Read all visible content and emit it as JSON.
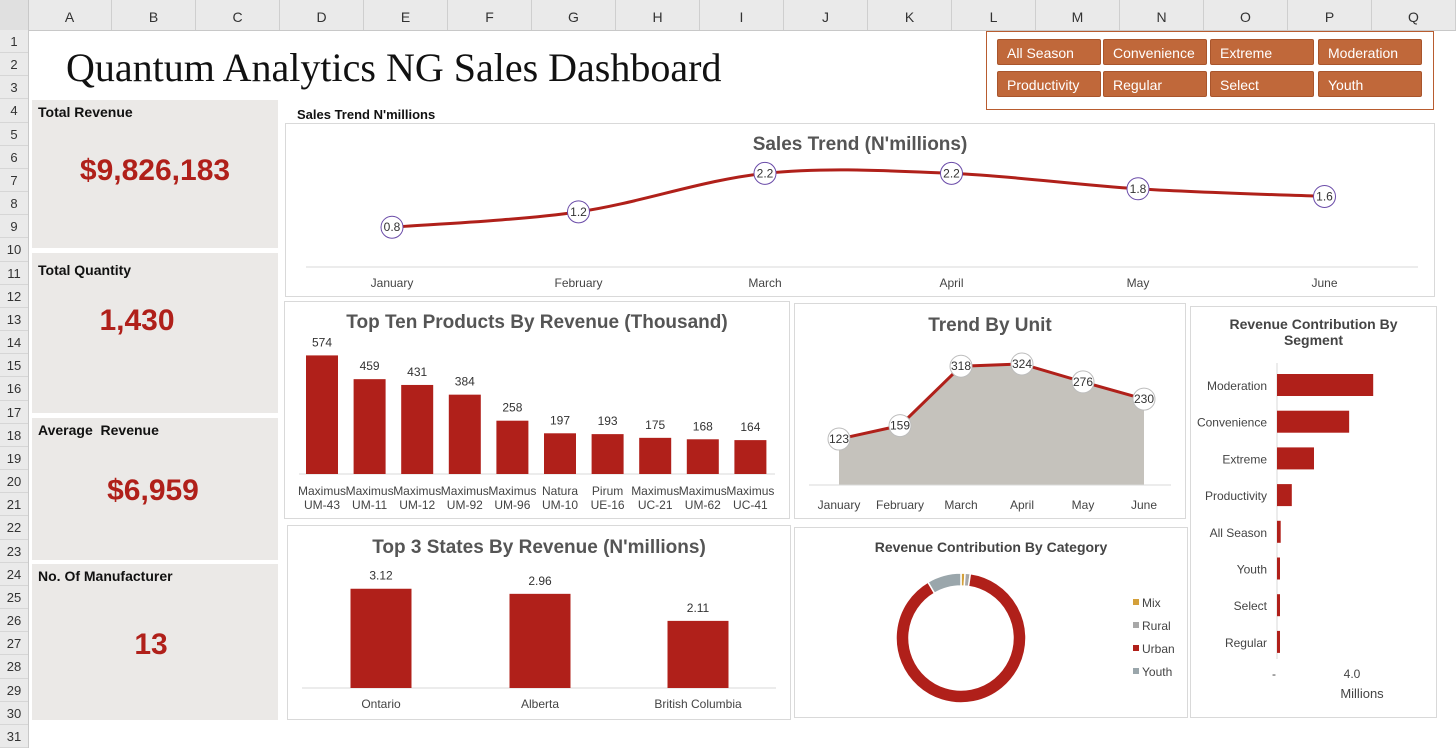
{
  "sheet": {
    "columns": [
      "A",
      "B",
      "C",
      "D",
      "E",
      "F",
      "G",
      "H",
      "I",
      "J",
      "K",
      "L",
      "M",
      "N",
      "O",
      "P",
      "Q"
    ],
    "rows": [
      "1",
      "2",
      "3",
      "4",
      "5",
      "6",
      "7",
      "8",
      "9",
      "10",
      "11",
      "12",
      "13",
      "14",
      "15",
      "16",
      "17",
      "18",
      "19",
      "20",
      "21",
      "22",
      "23",
      "24",
      "25",
      "26",
      "27",
      "28",
      "29",
      "30",
      "31"
    ]
  },
  "dashboard_title": "Quantum Analytics NG Sales Dashboard",
  "slicer": {
    "items": [
      "All Season",
      "Convenience",
      "Extreme",
      "Moderation",
      "Productivity",
      "Regular",
      "Select",
      "Youth"
    ]
  },
  "kpis": {
    "revenue": {
      "label": "Total Revenue",
      "value": "$9,826,183"
    },
    "quantity": {
      "label": "Total Quantity",
      "value": "1,430"
    },
    "average": {
      "label": "Average  Revenue",
      "value": "$6,959"
    },
    "manufacturers": {
      "label": "No. Of Manufacturer",
      "value": "13"
    }
  },
  "sales_trend_caption": "Sales Trend N'millions",
  "colors": {
    "accent": "#b0201a",
    "slicer": "#c0683a",
    "area": "#c5c2bc",
    "marker": "#6a4ba8",
    "panel_title": "#555555"
  },
  "chart_data": [
    {
      "id": "sales_trend",
      "type": "line",
      "title": "Sales Trend (N'millions)",
      "categories": [
        "January",
        "February",
        "March",
        "April",
        "May",
        "June"
      ],
      "values": [
        0.8,
        1.2,
        2.2,
        2.2,
        1.8,
        1.6
      ],
      "value_labels": [
        "0.8",
        "1.2",
        "2.2",
        "2.2",
        "1.8",
        "1.6"
      ],
      "ylim": [
        0,
        2.6
      ]
    },
    {
      "id": "top_products",
      "type": "bar",
      "title": "Top Ten Products By Revenue (Thousand)",
      "categories": [
        [
          "Maximus",
          "UM-43"
        ],
        [
          "Maximus",
          "UM-11"
        ],
        [
          "Maximus",
          "UM-12"
        ],
        [
          "Maximus",
          "UM-92"
        ],
        [
          "Maximus",
          "UM-96"
        ],
        [
          "Natura",
          "UM-10"
        ],
        [
          "Pirum",
          "UE-16"
        ],
        [
          "Maximus",
          "UC-21"
        ],
        [
          "Maximus",
          "UM-62"
        ],
        [
          "Maximus",
          "UC-41"
        ]
      ],
      "values": [
        574,
        459,
        431,
        384,
        258,
        197,
        193,
        175,
        168,
        164
      ],
      "value_labels": [
        "574",
        "459",
        "431",
        "384",
        "258",
        "197",
        "193",
        "175",
        "168",
        "164"
      ],
      "ylim": [
        0,
        620
      ]
    },
    {
      "id": "trend_by_unit",
      "type": "area",
      "title": "Trend By Unit",
      "categories": [
        "January",
        "February",
        "March",
        "April",
        "May",
        "June"
      ],
      "values": [
        123,
        159,
        318,
        324,
        276,
        230
      ],
      "value_labels": [
        "123",
        "159",
        "318",
        "324",
        "276",
        "230"
      ],
      "ylim": [
        0,
        340
      ]
    },
    {
      "id": "segment",
      "type": "bar",
      "orientation": "horizontal",
      "title": "Revenue Contribution By Segment",
      "categories": [
        "Moderation",
        "Convenience",
        "Extreme",
        "Productivity",
        "All Season",
        "Youth",
        "Select",
        "Regular"
      ],
      "values": [
        5.2,
        3.9,
        2.0,
        0.8,
        0.2,
        0.15,
        0.12,
        0.1
      ],
      "xlim": [
        0,
        8
      ],
      "tick_labels": [
        "-",
        "4.0"
      ],
      "xlabel": "Millions"
    },
    {
      "id": "top_states",
      "type": "bar",
      "title": "Top 3 States By Revenue (N'millions)",
      "categories": [
        "Ontario",
        "Alberta",
        "British Columbia"
      ],
      "values": [
        3.12,
        2.96,
        2.11
      ],
      "value_labels": [
        "3.12",
        "2.96",
        "2.11"
      ],
      "ylim": [
        0,
        3.4
      ]
    },
    {
      "id": "category",
      "type": "pie",
      "donut": true,
      "title": "Revenue Contribution By Category",
      "categories": [
        "Mix",
        "Rural",
        "Urban",
        "Youth"
      ],
      "values": [
        1.0,
        1.3,
        89.2,
        8.5
      ],
      "series_colors": [
        "#d4a03a",
        "#a8a8a8",
        "#b0201a",
        "#9aa6ab"
      ]
    }
  ]
}
